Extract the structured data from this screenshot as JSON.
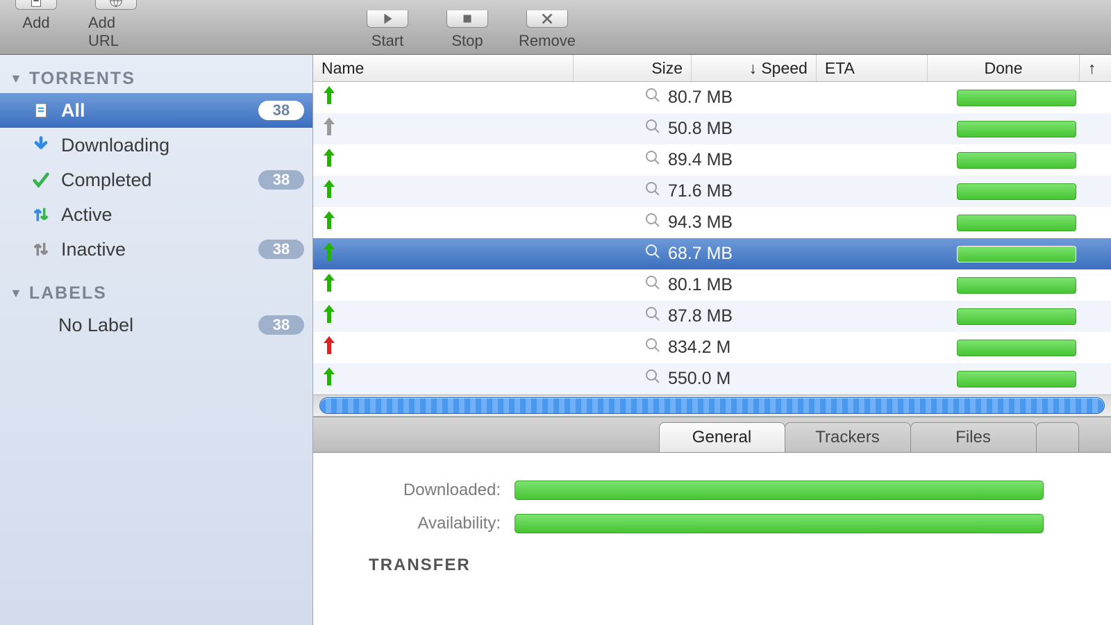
{
  "toolbar": {
    "add": "Add",
    "add_url": "Add URL",
    "start": "Start",
    "stop": "Stop",
    "remove": "Remove"
  },
  "sidebar": {
    "torrents_header": "TORRENTS",
    "labels_header": "LABELS",
    "items": [
      {
        "label": "All",
        "count": "38",
        "selected": true,
        "icon": "doc"
      },
      {
        "label": "Downloading",
        "count": "",
        "selected": false,
        "icon": "down"
      },
      {
        "label": "Completed",
        "count": "38",
        "selected": false,
        "icon": "check"
      },
      {
        "label": "Active",
        "count": "",
        "selected": false,
        "icon": "updown"
      },
      {
        "label": "Inactive",
        "count": "38",
        "selected": false,
        "icon": "updown-gray"
      }
    ],
    "label_items": [
      {
        "label": "No Label",
        "count": "38"
      }
    ]
  },
  "columns": {
    "name": "Name",
    "size": "Size",
    "speed": "↓ Speed",
    "eta": "ETA",
    "done": "Done"
  },
  "rows": [
    {
      "size": "80.7 MB",
      "arrow": "green",
      "selected": false
    },
    {
      "size": "50.8 MB",
      "arrow": "gray",
      "selected": false
    },
    {
      "size": "89.4 MB",
      "arrow": "green",
      "selected": false
    },
    {
      "size": "71.6 MB",
      "arrow": "green",
      "selected": false
    },
    {
      "size": "94.3 MB",
      "arrow": "green",
      "selected": false
    },
    {
      "size": "68.7 MB",
      "arrow": "green",
      "selected": true
    },
    {
      "size": "80.1 MB",
      "arrow": "green",
      "selected": false
    },
    {
      "size": "87.8 MB",
      "arrow": "green",
      "selected": false
    },
    {
      "size": "834.2 M",
      "arrow": "red",
      "selected": false
    },
    {
      "size": "550.0 M",
      "arrow": "green",
      "selected": false
    }
  ],
  "tabs": {
    "general": "General",
    "trackers": "Trackers",
    "files": "Files"
  },
  "detail": {
    "downloaded": "Downloaded:",
    "availability": "Availability:",
    "transfer": "TRANSFER"
  },
  "colors": {
    "arrow_green": "#24b300",
    "arrow_gray": "#9a9a9a",
    "arrow_red": "#d22"
  }
}
